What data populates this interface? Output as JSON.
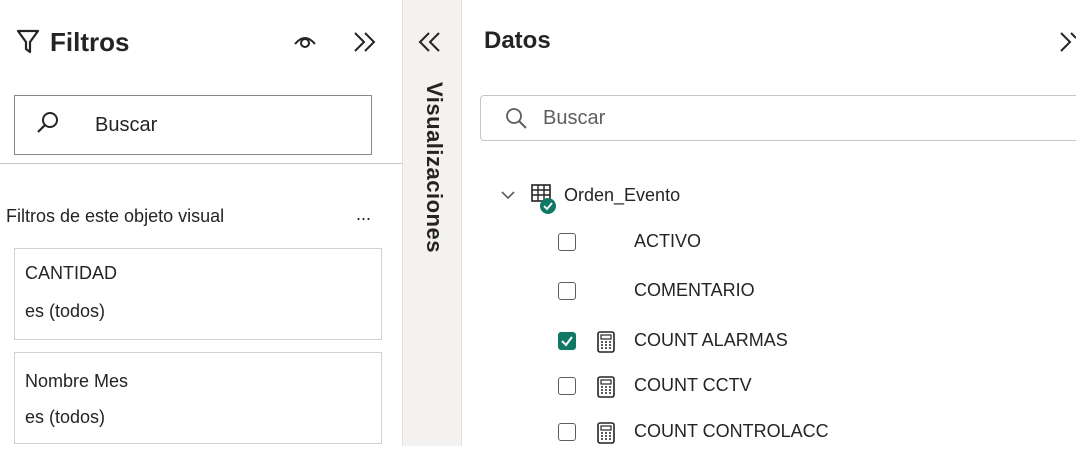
{
  "filters": {
    "title": "Filtros",
    "search_placeholder": "Buscar",
    "section_label": "Filtros de este objeto visual",
    "more_label": "...",
    "cards": [
      {
        "name": "CANTIDAD",
        "value": "es (todos)"
      },
      {
        "name": "Nombre Mes",
        "value": "es (todos)"
      }
    ]
  },
  "visualizations": {
    "label": "Visualizaciones"
  },
  "data": {
    "title": "Datos",
    "search_placeholder": "Buscar",
    "table": "Orden_Evento",
    "fields": [
      {
        "label": "ACTIVO",
        "checked": false,
        "icon": ""
      },
      {
        "label": "COMENTARIO",
        "checked": false,
        "icon": ""
      },
      {
        "label": "COUNT ALARMAS",
        "checked": true,
        "icon": "calculator-icon"
      },
      {
        "label": "COUNT CCTV",
        "checked": false,
        "icon": "calculator-icon"
      },
      {
        "label": "COUNT CONTROLACC",
        "checked": false,
        "icon": "calculator-icon"
      }
    ]
  },
  "colors": {
    "accent": "#117865",
    "strip": "#f3f2f1"
  }
}
